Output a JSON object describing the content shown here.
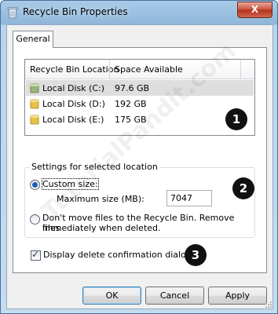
{
  "window": {
    "title": "Recycle Bin Properties",
    "close_label": "X"
  },
  "tabs": [
    {
      "label": "General"
    }
  ],
  "list": {
    "columns": [
      "Recycle Bin Location",
      "Space Available"
    ],
    "rows": [
      {
        "name": "Local Disk (C:)",
        "space": "97.6 GB",
        "selected": true
      },
      {
        "name": "Local Disk (D:)",
        "space": "192 GB"
      },
      {
        "name": "Local Disk (E:)",
        "space": "175 GB"
      }
    ]
  },
  "settings": {
    "group_title": "Settings for selected location",
    "custom_size_label": "Custom size:",
    "max_size_label": "Maximum size (MB):",
    "max_size_value": "7047",
    "dont_move_line1": "Don't move files to the Recycle Bin. Remove files",
    "dont_move_line2": "immediately when deleted."
  },
  "confirm": {
    "label": "Display delete confirmation dialog",
    "checked": true
  },
  "buttons": {
    "ok": "OK",
    "cancel": "Cancel",
    "apply": "Apply"
  },
  "badges": [
    "1",
    "2",
    "3"
  ],
  "watermark": "TutorialPandit.com",
  "colors": {
    "title_bar": "#a9cbe8",
    "close_button": "#c8503a",
    "selection": "#dedede"
  }
}
